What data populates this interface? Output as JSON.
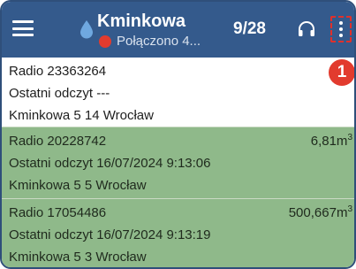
{
  "header": {
    "title": "Kminkowa",
    "status_text": "Połączono 4...",
    "counter": "9/28",
    "callout_number": "1",
    "colors": {
      "bar": "#345a8c",
      "status_dot": "#e23b2e",
      "callout": "#e23b2e"
    },
    "icons": [
      "menu-icon",
      "water-drop-icon",
      "headset-icon",
      "more-vert-icon"
    ]
  },
  "meters": [
    {
      "radio": "Radio 23363264",
      "last_reading": "Ostatni odczyt ---",
      "address": "Kminkowa 5 14 Wrocław",
      "value": "",
      "unit_sup": "",
      "status": "unread",
      "color": "#ffffff"
    },
    {
      "radio": "Radio 20228742",
      "last_reading": "Ostatni odczyt 16/07/2024 9:13:06",
      "address": "Kminkowa 5 5 Wrocław",
      "value": "6,81m",
      "unit_sup": "3",
      "status": "read",
      "color": "#8fb98a"
    },
    {
      "radio": "Radio 17054486",
      "last_reading": "Ostatni odczyt 16/07/2024 9:13:19",
      "address": "Kminkowa 5 3 Wrocław",
      "value": "500,667m",
      "unit_sup": "3",
      "status": "read",
      "color": "#8fb98a"
    }
  ]
}
